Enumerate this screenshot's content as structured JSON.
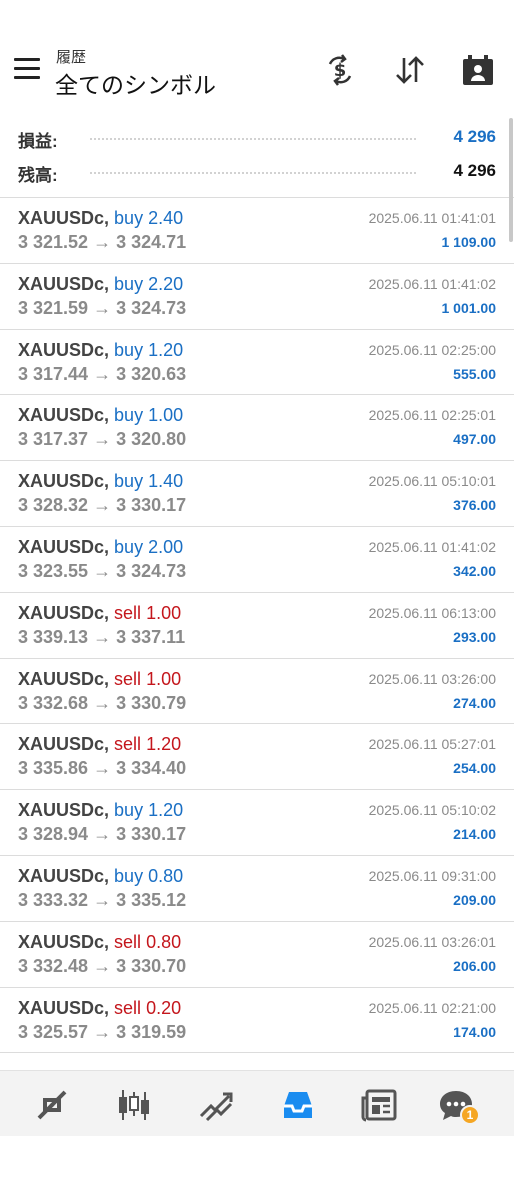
{
  "header": {
    "subtitle": "履歴",
    "title": "全てのシンボル",
    "icons": [
      "menu-icon",
      "dollar-swap-icon",
      "sort-icon",
      "calendar-icon"
    ]
  },
  "summary": {
    "profit_label": "損益:",
    "profit_value": "4 296",
    "balance_label": "残高:",
    "balance_value": "4 296",
    "colors": {
      "profit": "#1a6fc4",
      "balance": "#111111"
    }
  },
  "trades": [
    {
      "symbol": "XAUUSDc,",
      "side": "buy",
      "volume": "2.40",
      "open": "3 321.52",
      "arrow": "→",
      "close": "3 324.71",
      "time": "2025.06.11 01:41:01",
      "profit": "1 109.00"
    },
    {
      "symbol": "XAUUSDc,",
      "side": "buy",
      "volume": "2.20",
      "open": "3 321.59",
      "arrow": "→",
      "close": "3 324.73",
      "time": "2025.06.11 01:41:02",
      "profit": "1 001.00"
    },
    {
      "symbol": "XAUUSDc,",
      "side": "buy",
      "volume": "1.20",
      "open": "3 317.44",
      "arrow": "→",
      "close": "3 320.63",
      "time": "2025.06.11 02:25:00",
      "profit": "555.00"
    },
    {
      "symbol": "XAUUSDc,",
      "side": "buy",
      "volume": "1.00",
      "open": "3 317.37",
      "arrow": "→",
      "close": "3 320.80",
      "time": "2025.06.11 02:25:01",
      "profit": "497.00"
    },
    {
      "symbol": "XAUUSDc,",
      "side": "buy",
      "volume": "1.40",
      "open": "3 328.32",
      "arrow": "→",
      "close": "3 330.17",
      "time": "2025.06.11 05:10:01",
      "profit": "376.00"
    },
    {
      "symbol": "XAUUSDc,",
      "side": "buy",
      "volume": "2.00",
      "open": "3 323.55",
      "arrow": "→",
      "close": "3 324.73",
      "time": "2025.06.11 01:41:02",
      "profit": "342.00"
    },
    {
      "symbol": "XAUUSDc,",
      "side": "sell",
      "volume": "1.00",
      "open": "3 339.13",
      "arrow": "→",
      "close": "3 337.11",
      "time": "2025.06.11 06:13:00",
      "profit": "293.00"
    },
    {
      "symbol": "XAUUSDc,",
      "side": "sell",
      "volume": "1.00",
      "open": "3 332.68",
      "arrow": "→",
      "close": "3 330.79",
      "time": "2025.06.11 03:26:00",
      "profit": "274.00"
    },
    {
      "symbol": "XAUUSDc,",
      "side": "sell",
      "volume": "1.20",
      "open": "3 335.86",
      "arrow": "→",
      "close": "3 334.40",
      "time": "2025.06.11 05:27:01",
      "profit": "254.00"
    },
    {
      "symbol": "XAUUSDc,",
      "side": "buy",
      "volume": "1.20",
      "open": "3 328.94",
      "arrow": "→",
      "close": "3 330.17",
      "time": "2025.06.11 05:10:02",
      "profit": "214.00"
    },
    {
      "symbol": "XAUUSDc,",
      "side": "buy",
      "volume": "0.80",
      "open": "3 333.32",
      "arrow": "→",
      "close": "3 335.12",
      "time": "2025.06.11 09:31:00",
      "profit": "209.00"
    },
    {
      "symbol": "XAUUSDc,",
      "side": "sell",
      "volume": "0.80",
      "open": "3 332.48",
      "arrow": "→",
      "close": "3 330.70",
      "time": "2025.06.11 03:26:01",
      "profit": "206.00"
    },
    {
      "symbol": "XAUUSDc,",
      "side": "sell",
      "volume": "0.20",
      "open": "3 325.57",
      "arrow": "→",
      "close": "3 319.59",
      "time": "2025.06.11 02:21:00",
      "profit": "174.00"
    }
  ],
  "bottom_nav": {
    "items": [
      "quotes-icon",
      "chart-icon",
      "trade-icon",
      "history-icon",
      "news-icon",
      "messages-icon"
    ],
    "active": "history-icon",
    "message_badge": "1",
    "colors": {
      "active": "#1a8cf0",
      "inactive": "#555555",
      "badge": "#f5a623"
    }
  }
}
